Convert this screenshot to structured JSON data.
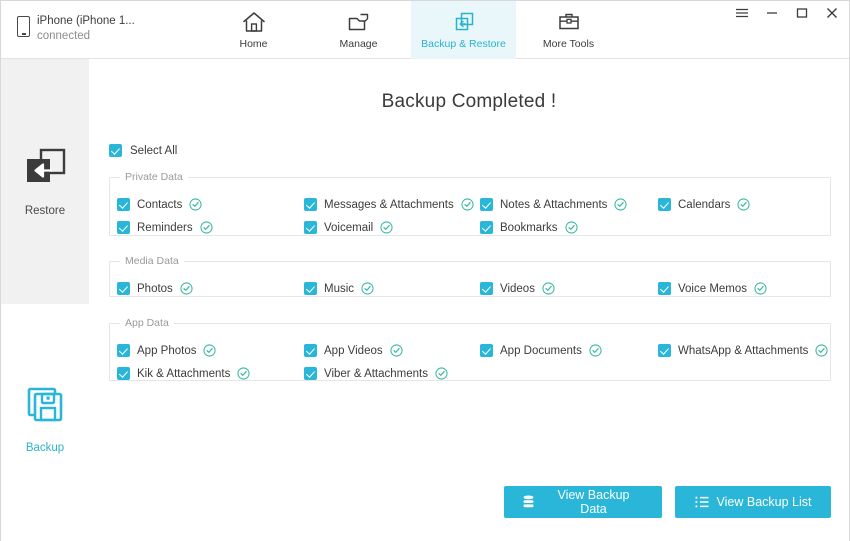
{
  "header": {
    "device_name": "iPhone (iPhone 1...",
    "device_status": "connected",
    "nav": [
      {
        "label": "Home",
        "icon": "home-icon",
        "active": false
      },
      {
        "label": "Manage",
        "icon": "folder-icon",
        "active": false
      },
      {
        "label": "Backup & Restore",
        "icon": "backup-restore-icon",
        "active": true
      },
      {
        "label": "More Tools",
        "icon": "toolbox-icon",
        "active": false
      }
    ],
    "window_controls": [
      {
        "name": "menu-icon",
        "glyph": "hamburger"
      },
      {
        "name": "minimize-icon",
        "glyph": "minus"
      },
      {
        "name": "maximize-icon",
        "glyph": "square"
      },
      {
        "name": "close-icon",
        "glyph": "x"
      }
    ]
  },
  "sidebar": {
    "restore": {
      "label": "Restore",
      "icon": "restore-icon"
    },
    "backup": {
      "label": "Backup",
      "icon": "backup-icon"
    }
  },
  "main": {
    "title": "Backup Completed !",
    "select_all": {
      "label": "Select All",
      "checked": true
    },
    "groups": [
      {
        "legend": "Private Data",
        "items": [
          {
            "label": "Contacts",
            "checked": true,
            "done": true,
            "col": 0,
            "row": 0
          },
          {
            "label": "Reminders",
            "checked": true,
            "done": true,
            "col": 0,
            "row": 1
          },
          {
            "label": "Messages & Attachments",
            "checked": true,
            "done": true,
            "col": 1,
            "row": 0
          },
          {
            "label": "Voicemail",
            "checked": true,
            "done": true,
            "col": 1,
            "row": 1
          },
          {
            "label": "Notes & Attachments",
            "checked": true,
            "done": true,
            "col": 2,
            "row": 0
          },
          {
            "label": "Bookmarks",
            "checked": true,
            "done": true,
            "col": 2,
            "row": 1
          },
          {
            "label": "Calendars",
            "checked": true,
            "done": true,
            "col": 3,
            "row": 0
          }
        ]
      },
      {
        "legend": "Media Data",
        "items": [
          {
            "label": "Photos",
            "checked": true,
            "done": true,
            "col": 0,
            "row": 0
          },
          {
            "label": "Music",
            "checked": true,
            "done": true,
            "col": 1,
            "row": 0
          },
          {
            "label": "Videos",
            "checked": true,
            "done": true,
            "col": 2,
            "row": 0
          },
          {
            "label": "Voice Memos",
            "checked": true,
            "done": true,
            "col": 3,
            "row": 0
          }
        ]
      },
      {
        "legend": "App Data",
        "items": [
          {
            "label": "App Photos",
            "checked": true,
            "done": true,
            "col": 0,
            "row": 0
          },
          {
            "label": "Kik & Attachments",
            "checked": true,
            "done": true,
            "col": 0,
            "row": 1
          },
          {
            "label": "App Videos",
            "checked": true,
            "done": true,
            "col": 1,
            "row": 0
          },
          {
            "label": "Viber & Attachments",
            "checked": true,
            "done": true,
            "col": 1,
            "row": 1
          },
          {
            "label": "App Documents",
            "checked": true,
            "done": true,
            "col": 2,
            "row": 0
          },
          {
            "label": "WhatsApp & Attachments",
            "checked": true,
            "done": true,
            "col": 3,
            "row": 0
          }
        ]
      }
    ]
  },
  "footer": {
    "view_backup_data": {
      "label": "View Backup Data",
      "icon": "database-icon"
    },
    "view_backup_list": {
      "label": "View Backup List",
      "icon": "list-icon"
    }
  },
  "colors": {
    "accent": "#29b6d8",
    "accent_light": "#e9f7fa",
    "done_green": "#3bb8a4",
    "sidebar_active": "#f1f1f1",
    "text": "#3c3c3c",
    "muted": "#9a9a9a"
  }
}
